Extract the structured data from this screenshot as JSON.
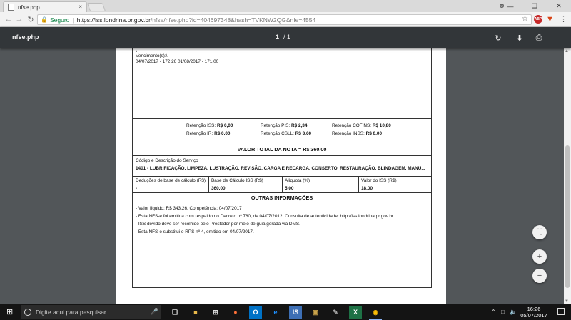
{
  "browser": {
    "tab_title": "nfse.php",
    "tab_close": "×",
    "secure_label": "Seguro",
    "url_host": "https://iss.londrina.pr.gov.br",
    "url_path": "/nfse/nfse.php?id=404697348&hash=TVKNW2QG&nfe=4554",
    "ext_badge": "ABP"
  },
  "pdf_viewer": {
    "title": "nfse.php",
    "current_page": "1",
    "page_separator": "/",
    "total_pages": "1"
  },
  "document": {
    "backslash": "\\",
    "due_label": "Vencimento(s):\\",
    "due_dates": "04/07/2017 - 172,26   01/08/2017 - 171,00",
    "retentions": [
      {
        "label": "Retenção ISS:",
        "value": "R$ 0,00"
      },
      {
        "label": "Retenção PIS:",
        "value": "R$ 2,34"
      },
      {
        "label": "Retenção COFINS:",
        "value": "R$ 10,80"
      },
      {
        "label": "Retenção IR:",
        "value": "R$ 0,00"
      },
      {
        "label": "Retenção CSLL:",
        "value": "R$ 3,60"
      },
      {
        "label": "Retenção INSS:",
        "value": "R$ 0,00"
      }
    ],
    "total_label": "VALOR TOTAL DA NOTA = R$ 360,00",
    "service_label": "Código e Descrição do Serviço",
    "service_desc": "1401 - LUBRIFICAÇÃO, LIMPEZA, LUSTRAÇÃO, REVISÃO, CARGA E RECARGA, CONSERTO, RESTAURAÇÃO, BLINDAGEM, MANU...",
    "calc_headers": [
      "Deduções de base de cálculo (R$)",
      "Base de Cálculo ISS (R$)",
      "Alíquota (%)",
      "Valor do ISS (R$)"
    ],
    "calc_values": [
      "-",
      "360,00",
      "5,00",
      "18,00"
    ],
    "other_info_title": "OUTRAS INFORMAÇÕES",
    "other_info": [
      "- Valor líquido: R$ 343,26. Competência: 04/07/2017",
      "- Esta NFS-e foi emitida com respaldo no Decreto nº 780, de 04/07/2012. Consulta de autenticidade: http://iss.londrina.pr.gov.br",
      "- ISS devido deve ser recolhido pelo Prestador por meio de guia gerada via DMS.",
      "- Esta NFS-e substitui o RPS nº 4, emitido em 04/07/2017."
    ]
  },
  "taskbar": {
    "search_placeholder": "Digite aqui para pesquisar",
    "time": "16:26",
    "date": "05/07/2017"
  }
}
